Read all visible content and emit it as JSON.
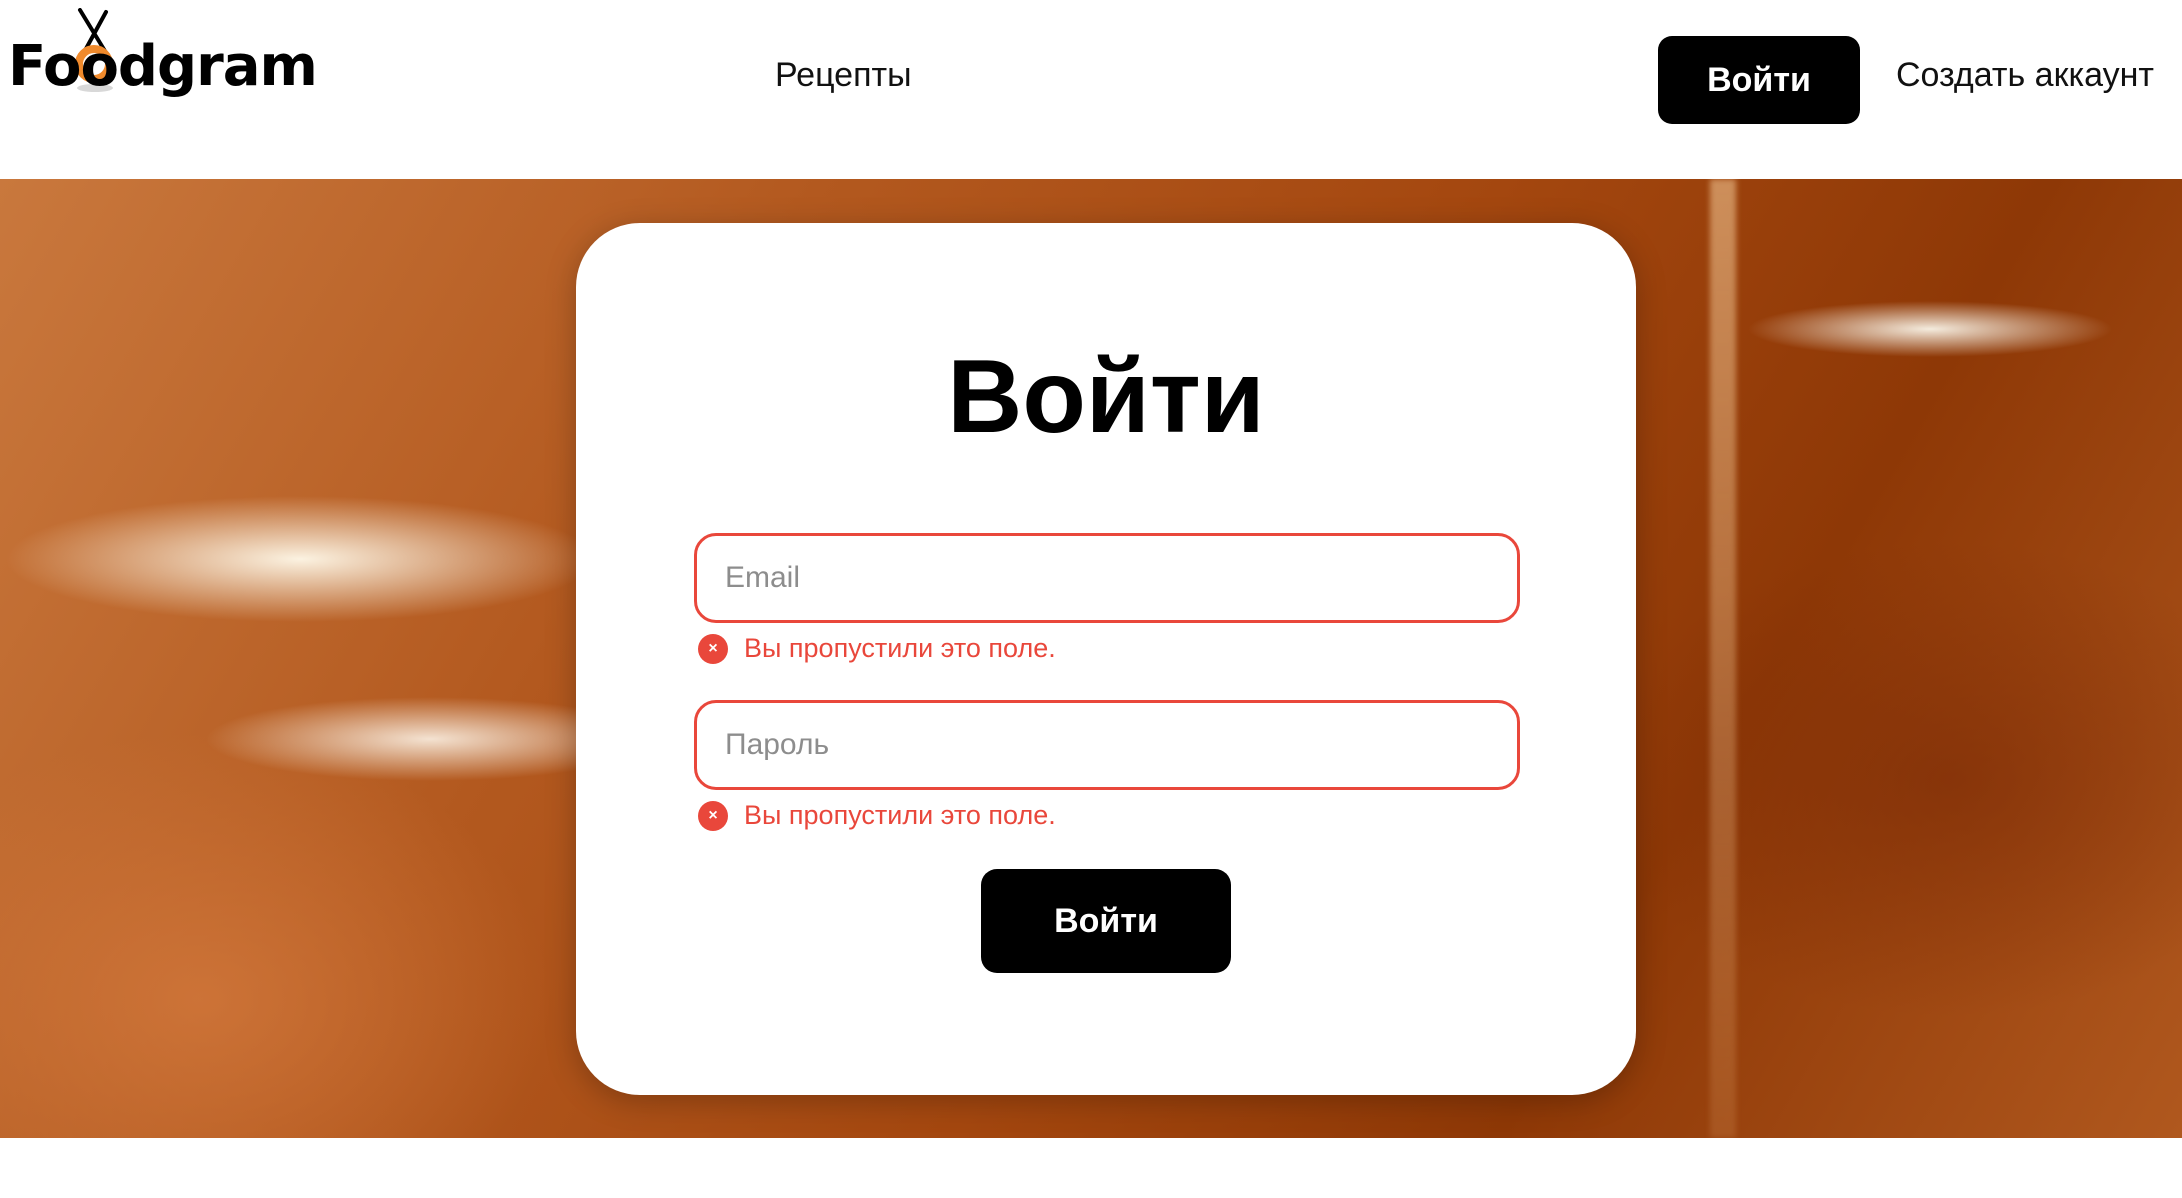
{
  "header": {
    "logo_text": "Foodgram",
    "nav_recipes": "Рецепты",
    "login_button": "Войти",
    "signup_link": "Создать аккаунт"
  },
  "form": {
    "title": "Войти",
    "email": {
      "placeholder": "Email",
      "value": "",
      "error": "Вы пропустили это поле."
    },
    "password": {
      "placeholder": "Пароль",
      "value": "",
      "error": "Вы пропустили это поле."
    },
    "submit_label": "Войти"
  },
  "colors": {
    "accent": "#000000",
    "error": "#e9473b",
    "logo_accent": "#f08a2c",
    "background_hero": "#a4470f"
  },
  "icons": {
    "error_icon": "×"
  }
}
